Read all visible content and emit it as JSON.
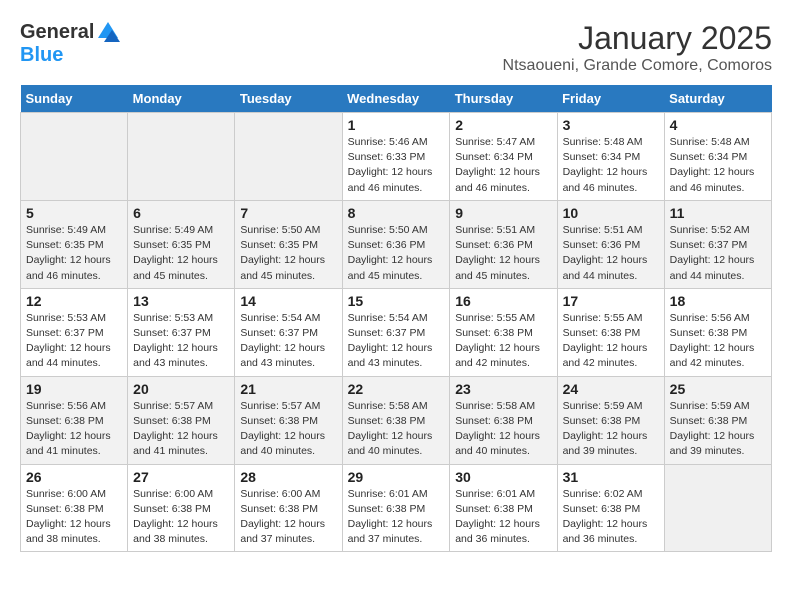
{
  "logo": {
    "general": "General",
    "blue": "Blue"
  },
  "header": {
    "title": "January 2025",
    "subtitle": "Ntsaoueni, Grande Comore, Comoros"
  },
  "weekdays": [
    "Sunday",
    "Monday",
    "Tuesday",
    "Wednesday",
    "Thursday",
    "Friday",
    "Saturday"
  ],
  "weeks": [
    [
      {
        "day": "",
        "info": ""
      },
      {
        "day": "",
        "info": ""
      },
      {
        "day": "",
        "info": ""
      },
      {
        "day": "1",
        "info": "Sunrise: 5:46 AM\nSunset: 6:33 PM\nDaylight: 12 hours\nand 46 minutes."
      },
      {
        "day": "2",
        "info": "Sunrise: 5:47 AM\nSunset: 6:34 PM\nDaylight: 12 hours\nand 46 minutes."
      },
      {
        "day": "3",
        "info": "Sunrise: 5:48 AM\nSunset: 6:34 PM\nDaylight: 12 hours\nand 46 minutes."
      },
      {
        "day": "4",
        "info": "Sunrise: 5:48 AM\nSunset: 6:34 PM\nDaylight: 12 hours\nand 46 minutes."
      }
    ],
    [
      {
        "day": "5",
        "info": "Sunrise: 5:49 AM\nSunset: 6:35 PM\nDaylight: 12 hours\nand 46 minutes."
      },
      {
        "day": "6",
        "info": "Sunrise: 5:49 AM\nSunset: 6:35 PM\nDaylight: 12 hours\nand 45 minutes."
      },
      {
        "day": "7",
        "info": "Sunrise: 5:50 AM\nSunset: 6:35 PM\nDaylight: 12 hours\nand 45 minutes."
      },
      {
        "day": "8",
        "info": "Sunrise: 5:50 AM\nSunset: 6:36 PM\nDaylight: 12 hours\nand 45 minutes."
      },
      {
        "day": "9",
        "info": "Sunrise: 5:51 AM\nSunset: 6:36 PM\nDaylight: 12 hours\nand 45 minutes."
      },
      {
        "day": "10",
        "info": "Sunrise: 5:51 AM\nSunset: 6:36 PM\nDaylight: 12 hours\nand 44 minutes."
      },
      {
        "day": "11",
        "info": "Sunrise: 5:52 AM\nSunset: 6:37 PM\nDaylight: 12 hours\nand 44 minutes."
      }
    ],
    [
      {
        "day": "12",
        "info": "Sunrise: 5:53 AM\nSunset: 6:37 PM\nDaylight: 12 hours\nand 44 minutes."
      },
      {
        "day": "13",
        "info": "Sunrise: 5:53 AM\nSunset: 6:37 PM\nDaylight: 12 hours\nand 43 minutes."
      },
      {
        "day": "14",
        "info": "Sunrise: 5:54 AM\nSunset: 6:37 PM\nDaylight: 12 hours\nand 43 minutes."
      },
      {
        "day": "15",
        "info": "Sunrise: 5:54 AM\nSunset: 6:37 PM\nDaylight: 12 hours\nand 43 minutes."
      },
      {
        "day": "16",
        "info": "Sunrise: 5:55 AM\nSunset: 6:38 PM\nDaylight: 12 hours\nand 42 minutes."
      },
      {
        "day": "17",
        "info": "Sunrise: 5:55 AM\nSunset: 6:38 PM\nDaylight: 12 hours\nand 42 minutes."
      },
      {
        "day": "18",
        "info": "Sunrise: 5:56 AM\nSunset: 6:38 PM\nDaylight: 12 hours\nand 42 minutes."
      }
    ],
    [
      {
        "day": "19",
        "info": "Sunrise: 5:56 AM\nSunset: 6:38 PM\nDaylight: 12 hours\nand 41 minutes."
      },
      {
        "day": "20",
        "info": "Sunrise: 5:57 AM\nSunset: 6:38 PM\nDaylight: 12 hours\nand 41 minutes."
      },
      {
        "day": "21",
        "info": "Sunrise: 5:57 AM\nSunset: 6:38 PM\nDaylight: 12 hours\nand 40 minutes."
      },
      {
        "day": "22",
        "info": "Sunrise: 5:58 AM\nSunset: 6:38 PM\nDaylight: 12 hours\nand 40 minutes."
      },
      {
        "day": "23",
        "info": "Sunrise: 5:58 AM\nSunset: 6:38 PM\nDaylight: 12 hours\nand 40 minutes."
      },
      {
        "day": "24",
        "info": "Sunrise: 5:59 AM\nSunset: 6:38 PM\nDaylight: 12 hours\nand 39 minutes."
      },
      {
        "day": "25",
        "info": "Sunrise: 5:59 AM\nSunset: 6:38 PM\nDaylight: 12 hours\nand 39 minutes."
      }
    ],
    [
      {
        "day": "26",
        "info": "Sunrise: 6:00 AM\nSunset: 6:38 PM\nDaylight: 12 hours\nand 38 minutes."
      },
      {
        "day": "27",
        "info": "Sunrise: 6:00 AM\nSunset: 6:38 PM\nDaylight: 12 hours\nand 38 minutes."
      },
      {
        "day": "28",
        "info": "Sunrise: 6:00 AM\nSunset: 6:38 PM\nDaylight: 12 hours\nand 37 minutes."
      },
      {
        "day": "29",
        "info": "Sunrise: 6:01 AM\nSunset: 6:38 PM\nDaylight: 12 hours\nand 37 minutes."
      },
      {
        "day": "30",
        "info": "Sunrise: 6:01 AM\nSunset: 6:38 PM\nDaylight: 12 hours\nand 36 minutes."
      },
      {
        "day": "31",
        "info": "Sunrise: 6:02 AM\nSunset: 6:38 PM\nDaylight: 12 hours\nand 36 minutes."
      },
      {
        "day": "",
        "info": ""
      }
    ]
  ]
}
